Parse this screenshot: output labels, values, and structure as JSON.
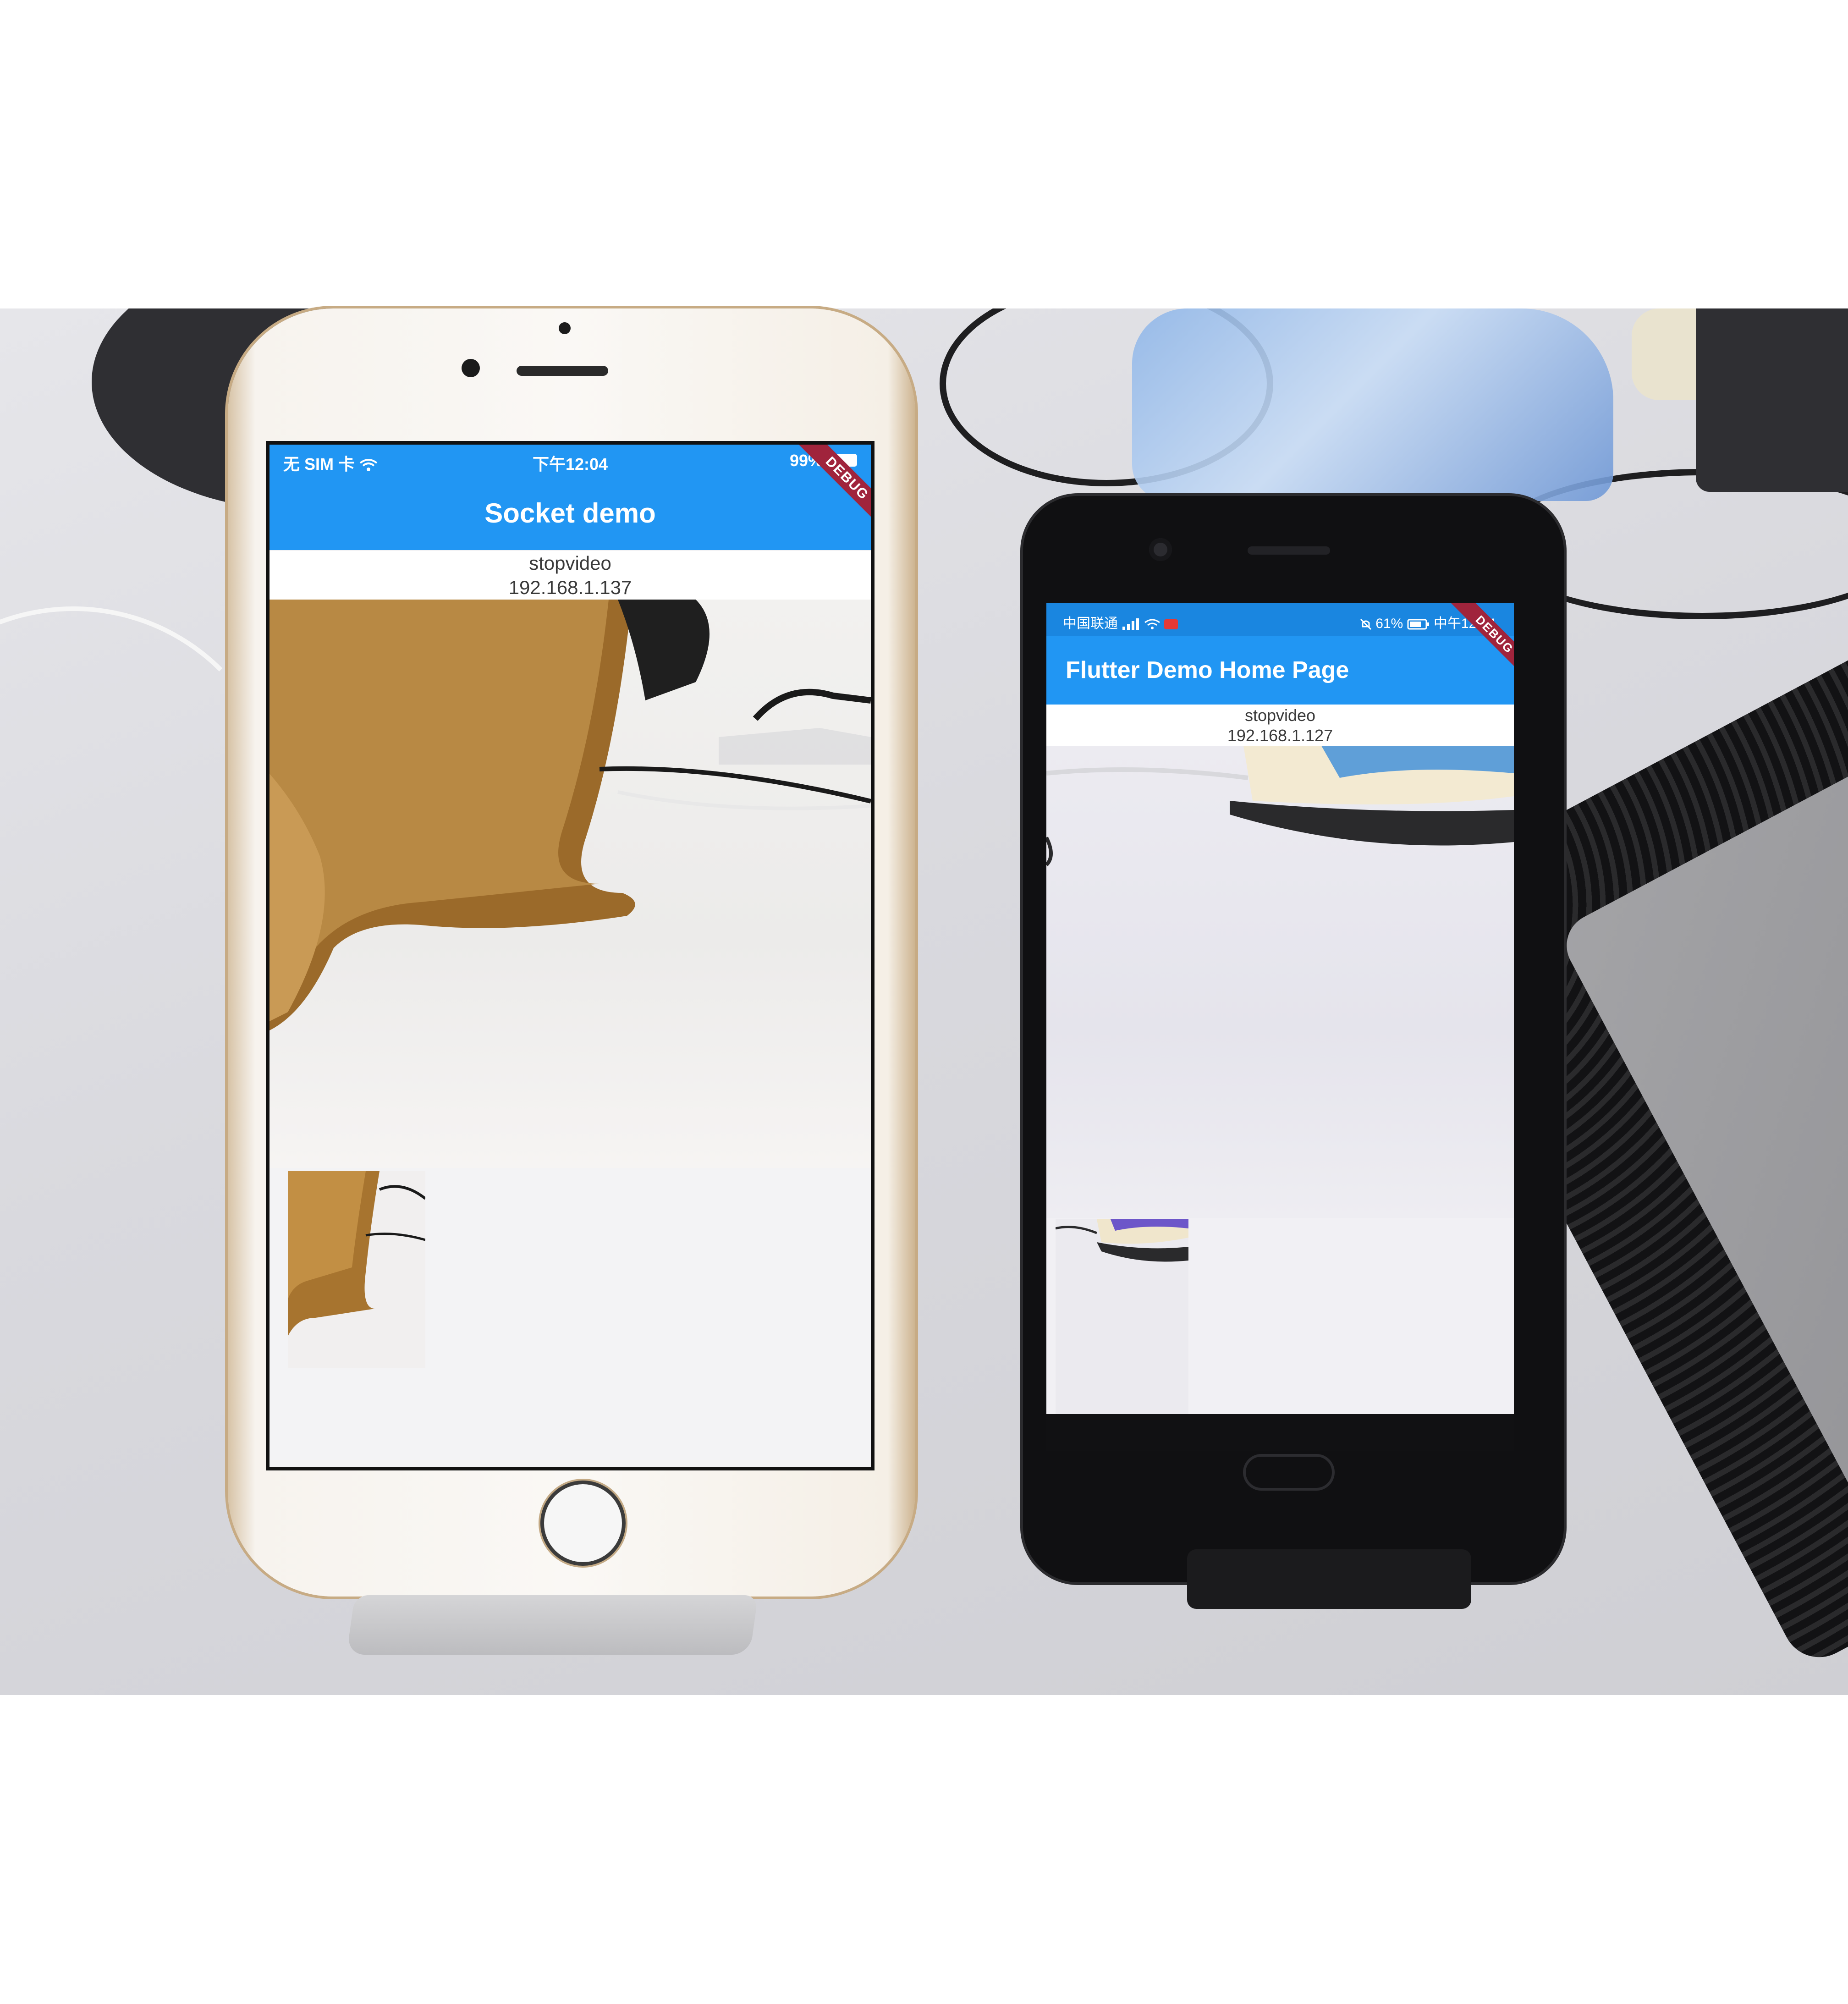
{
  "phone_ios": {
    "status": {
      "carrier": "无 SIM 卡",
      "time": "下午12:04",
      "battery": "99%"
    },
    "app_bar_title": "Socket demo",
    "debug_banner": "DEBUG",
    "action_label": "stopvideo",
    "ip_address": "192.168.1.137"
  },
  "phone_android": {
    "status": {
      "carrier": "中国联通",
      "battery": "61%",
      "time": "中午12:04"
    },
    "app_bar_title": "Flutter Demo Home Page",
    "debug_banner": "DEBUG",
    "action_label": "stopvideo",
    "ip_address": "192.168.1.127"
  },
  "colors": {
    "app_bar_blue": "#2196f3",
    "debug_banner_red": "#a0243c",
    "ios_body_gold": "#d7c3a6",
    "android_body_black": "#101012"
  },
  "icons": [
    "wifi-icon",
    "battery-icon",
    "signal-icon",
    "camera-record-icon",
    "mute-icon"
  ]
}
